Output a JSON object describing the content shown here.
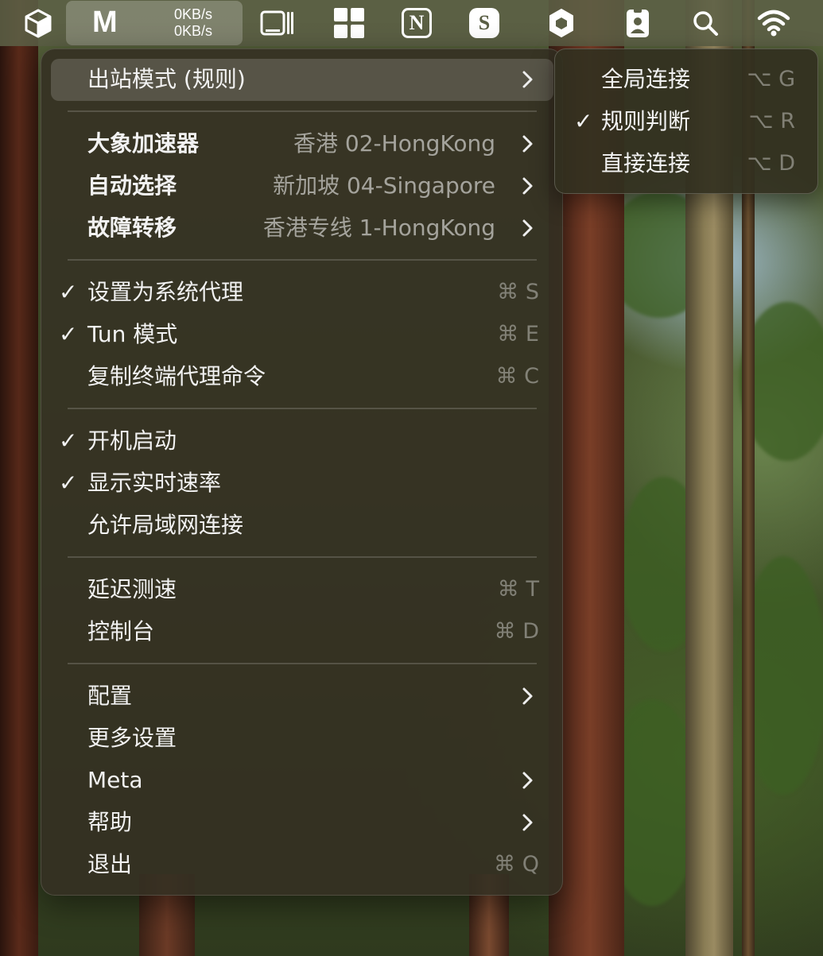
{
  "menubar": {
    "app_icon": "cube-icon",
    "clash_letter": "M",
    "upload_speed": "0KB/s",
    "download_speed": "0KB/s",
    "icons": [
      "cube-icon",
      "stage-manager-icon",
      "windows-grid-icon",
      "notion-icon",
      "s-app-icon",
      "hexagon-icon",
      "id-badge-icon",
      "search-icon",
      "wifi-icon"
    ],
    "notion_letter": "N",
    "s_letter": "S"
  },
  "menu": {
    "outbound_mode": "出站模式 (规则)",
    "groups": [
      {
        "name": "大象加速器",
        "value": "香港 02-HongKong"
      },
      {
        "name": "自动选择",
        "value": "新加坡 04-Singapore"
      },
      {
        "name": "故障转移",
        "value": "香港专线 1-HongKong"
      }
    ],
    "proxy_items": [
      {
        "label": "设置为系统代理",
        "checked": true,
        "shortcut": "⌘ S"
      },
      {
        "label": "Tun 模式",
        "checked": true,
        "shortcut": "⌘ E"
      },
      {
        "label": "复制终端代理命令",
        "checked": false,
        "shortcut": "⌘ C"
      }
    ],
    "startup_items": [
      {
        "label": "开机启动",
        "checked": true
      },
      {
        "label": "显示实时速率",
        "checked": true
      },
      {
        "label": "允许局域网连接",
        "checked": false
      }
    ],
    "tool_items": [
      {
        "label": "延迟测速",
        "shortcut": "⌘ T"
      },
      {
        "label": "控制台",
        "shortcut": "⌘ D"
      }
    ],
    "bottom_items": [
      {
        "label": "配置",
        "has_submenu": true
      },
      {
        "label": "更多设置",
        "has_submenu": false
      },
      {
        "label": "Meta",
        "has_submenu": true
      },
      {
        "label": "帮助",
        "has_submenu": true
      },
      {
        "label": "退出",
        "shortcut": "⌘ Q"
      }
    ],
    "check_glyph": "✓"
  },
  "submenu": {
    "items": [
      {
        "label": "全局连接",
        "checked": false,
        "shortcut": "⌥ G"
      },
      {
        "label": "规则判断",
        "checked": true,
        "shortcut": "⌥ R"
      },
      {
        "label": "直接连接",
        "checked": false,
        "shortcut": "⌥ D"
      }
    ]
  }
}
